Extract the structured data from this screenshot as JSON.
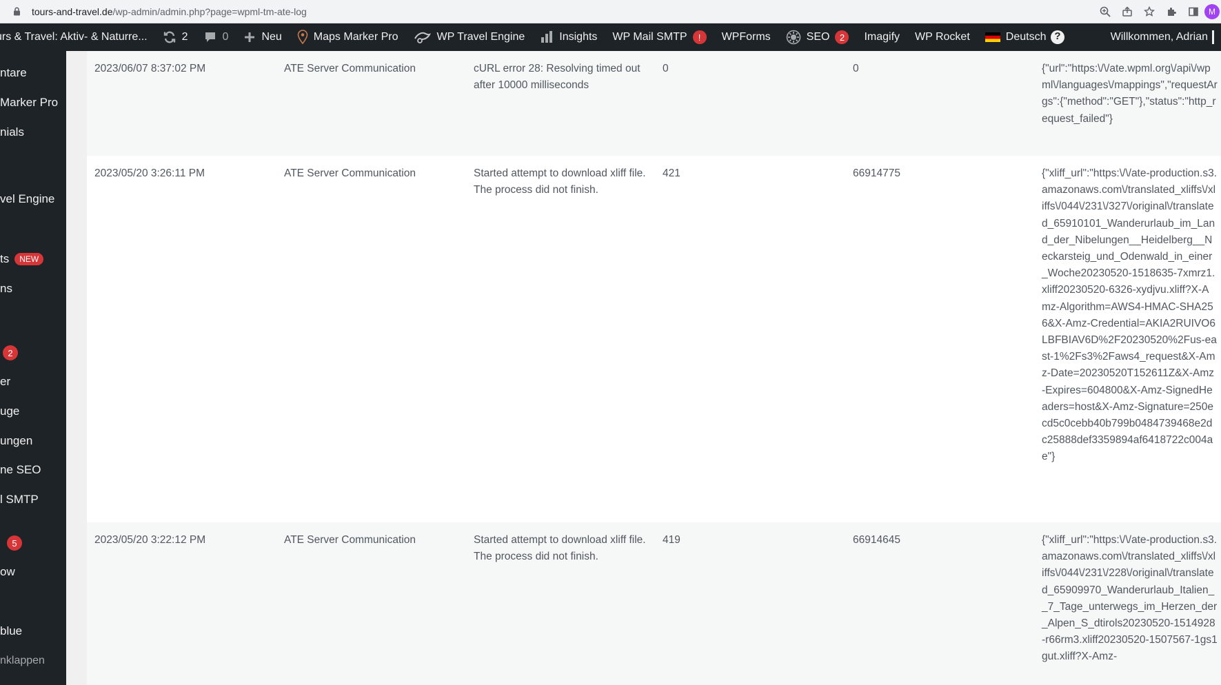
{
  "browser": {
    "url_domain": "tours-and-travel.de",
    "url_path": "/wp-admin/admin.php?page=wpml-tm-ate-log",
    "profile_initial": "M"
  },
  "admin_bar": {
    "site_name": "urs & Travel: Aktiv- & Naturre...",
    "updates_count": "2",
    "comments_count": "0",
    "new_label": "Neu",
    "maps_marker_label": "Maps Marker Pro",
    "wp_travel_engine_label": "WP Travel Engine",
    "insights_label": "Insights",
    "wp_mail_smtp_label": "WP Mail SMTP",
    "wp_mail_smtp_badge": "!",
    "wpforms_label": "WPForms",
    "seo_label": "SEO",
    "seo_badge": "2",
    "imagify_label": "Imagify",
    "wp_rocket_label": "WP Rocket",
    "language_label": "Deutsch",
    "help_glyph": "?",
    "welcome_text": "Willkommen, Adrian"
  },
  "sidebar": {
    "items": [
      {
        "label": "ntare"
      },
      {
        "label": "Marker Pro"
      },
      {
        "label": "nials"
      },
      {
        "label": "vel Engine"
      },
      {
        "label": "ts",
        "badge": "NEW"
      },
      {
        "label": "ns"
      },
      {
        "label": "",
        "count": "2"
      },
      {
        "label": "er"
      },
      {
        "label": "uge"
      },
      {
        "label": "ungen"
      },
      {
        "label": "ne SEO"
      },
      {
        "label": "l SMTP"
      },
      {
        "label": "",
        "count": "5"
      },
      {
        "label": "ow"
      },
      {
        "label": "blue"
      },
      {
        "label": "nklappen"
      }
    ]
  },
  "log_rows": [
    {
      "date": "2023/06/07 8:37:02 PM",
      "component": "ATE Server Communication",
      "description": "cURL error 28: Resolving timed out after 10000 milliseconds",
      "col_a": "0",
      "col_b": "0",
      "extra": "{\"url\":\"https:\\/\\/ate.wpml.org\\/api\\/wpml\\/languages\\/mappings\",\"requestArgs\":{\"method\":\"GET\"},\"status\":\"http_request_failed\"}"
    },
    {
      "date": "2023/05/20 3:26:11 PM",
      "component": "ATE Server Communication",
      "description": "Started attempt to download xliff file. The process did not finish.",
      "col_a": "421",
      "col_b": "66914775",
      "extra": "{\"xliff_url\":\"https:\\/\\/ate-production.s3.amazonaws.com\\/translated_xliffs\\/xliffs\\/044\\/231\\/327\\/original\\/translated_65910101_Wanderurlaub_im_Land_der_Nibelungen__Heidelberg__Neckarsteig_und_Odenwald_in_einer_Woche20230520-1518635-7xmrz1.xliff20230520-6326-xydjvu.xliff?X-Amz-Algorithm=AWS4-HMAC-SHA256&X-Amz-Credential=AKIA2RUIVO6LBFBIAV6D%2F20230520%2Fus-east-1%2Fs3%2Faws4_request&X-Amz-Date=20230520T152611Z&X-Amz-Expires=604800&X-Amz-SignedHeaders=host&X-Amz-Signature=250ecd5c0cebb40b799b0484739468e2dc25888def3359894af6418722c004ae\"}"
    },
    {
      "date": "2023/05/20 3:22:12 PM",
      "component": "ATE Server Communication",
      "description": "Started attempt to download xliff file. The process did not finish.",
      "col_a": "419",
      "col_b": "66914645",
      "extra": "{\"xliff_url\":\"https:\\/\\/ate-production.s3.amazonaws.com\\/translated_xliffs\\/xliffs\\/044\\/231\\/228\\/original\\/translated_65909970_Wanderurlaub_Italien__7_Tage_unterwegs_im_Herzen_der_Alpen_S_dtirols20230520-1514928-r66rm3.xliff20230520-1507567-1gs1gut.xliff?X-Amz-"
    }
  ]
}
